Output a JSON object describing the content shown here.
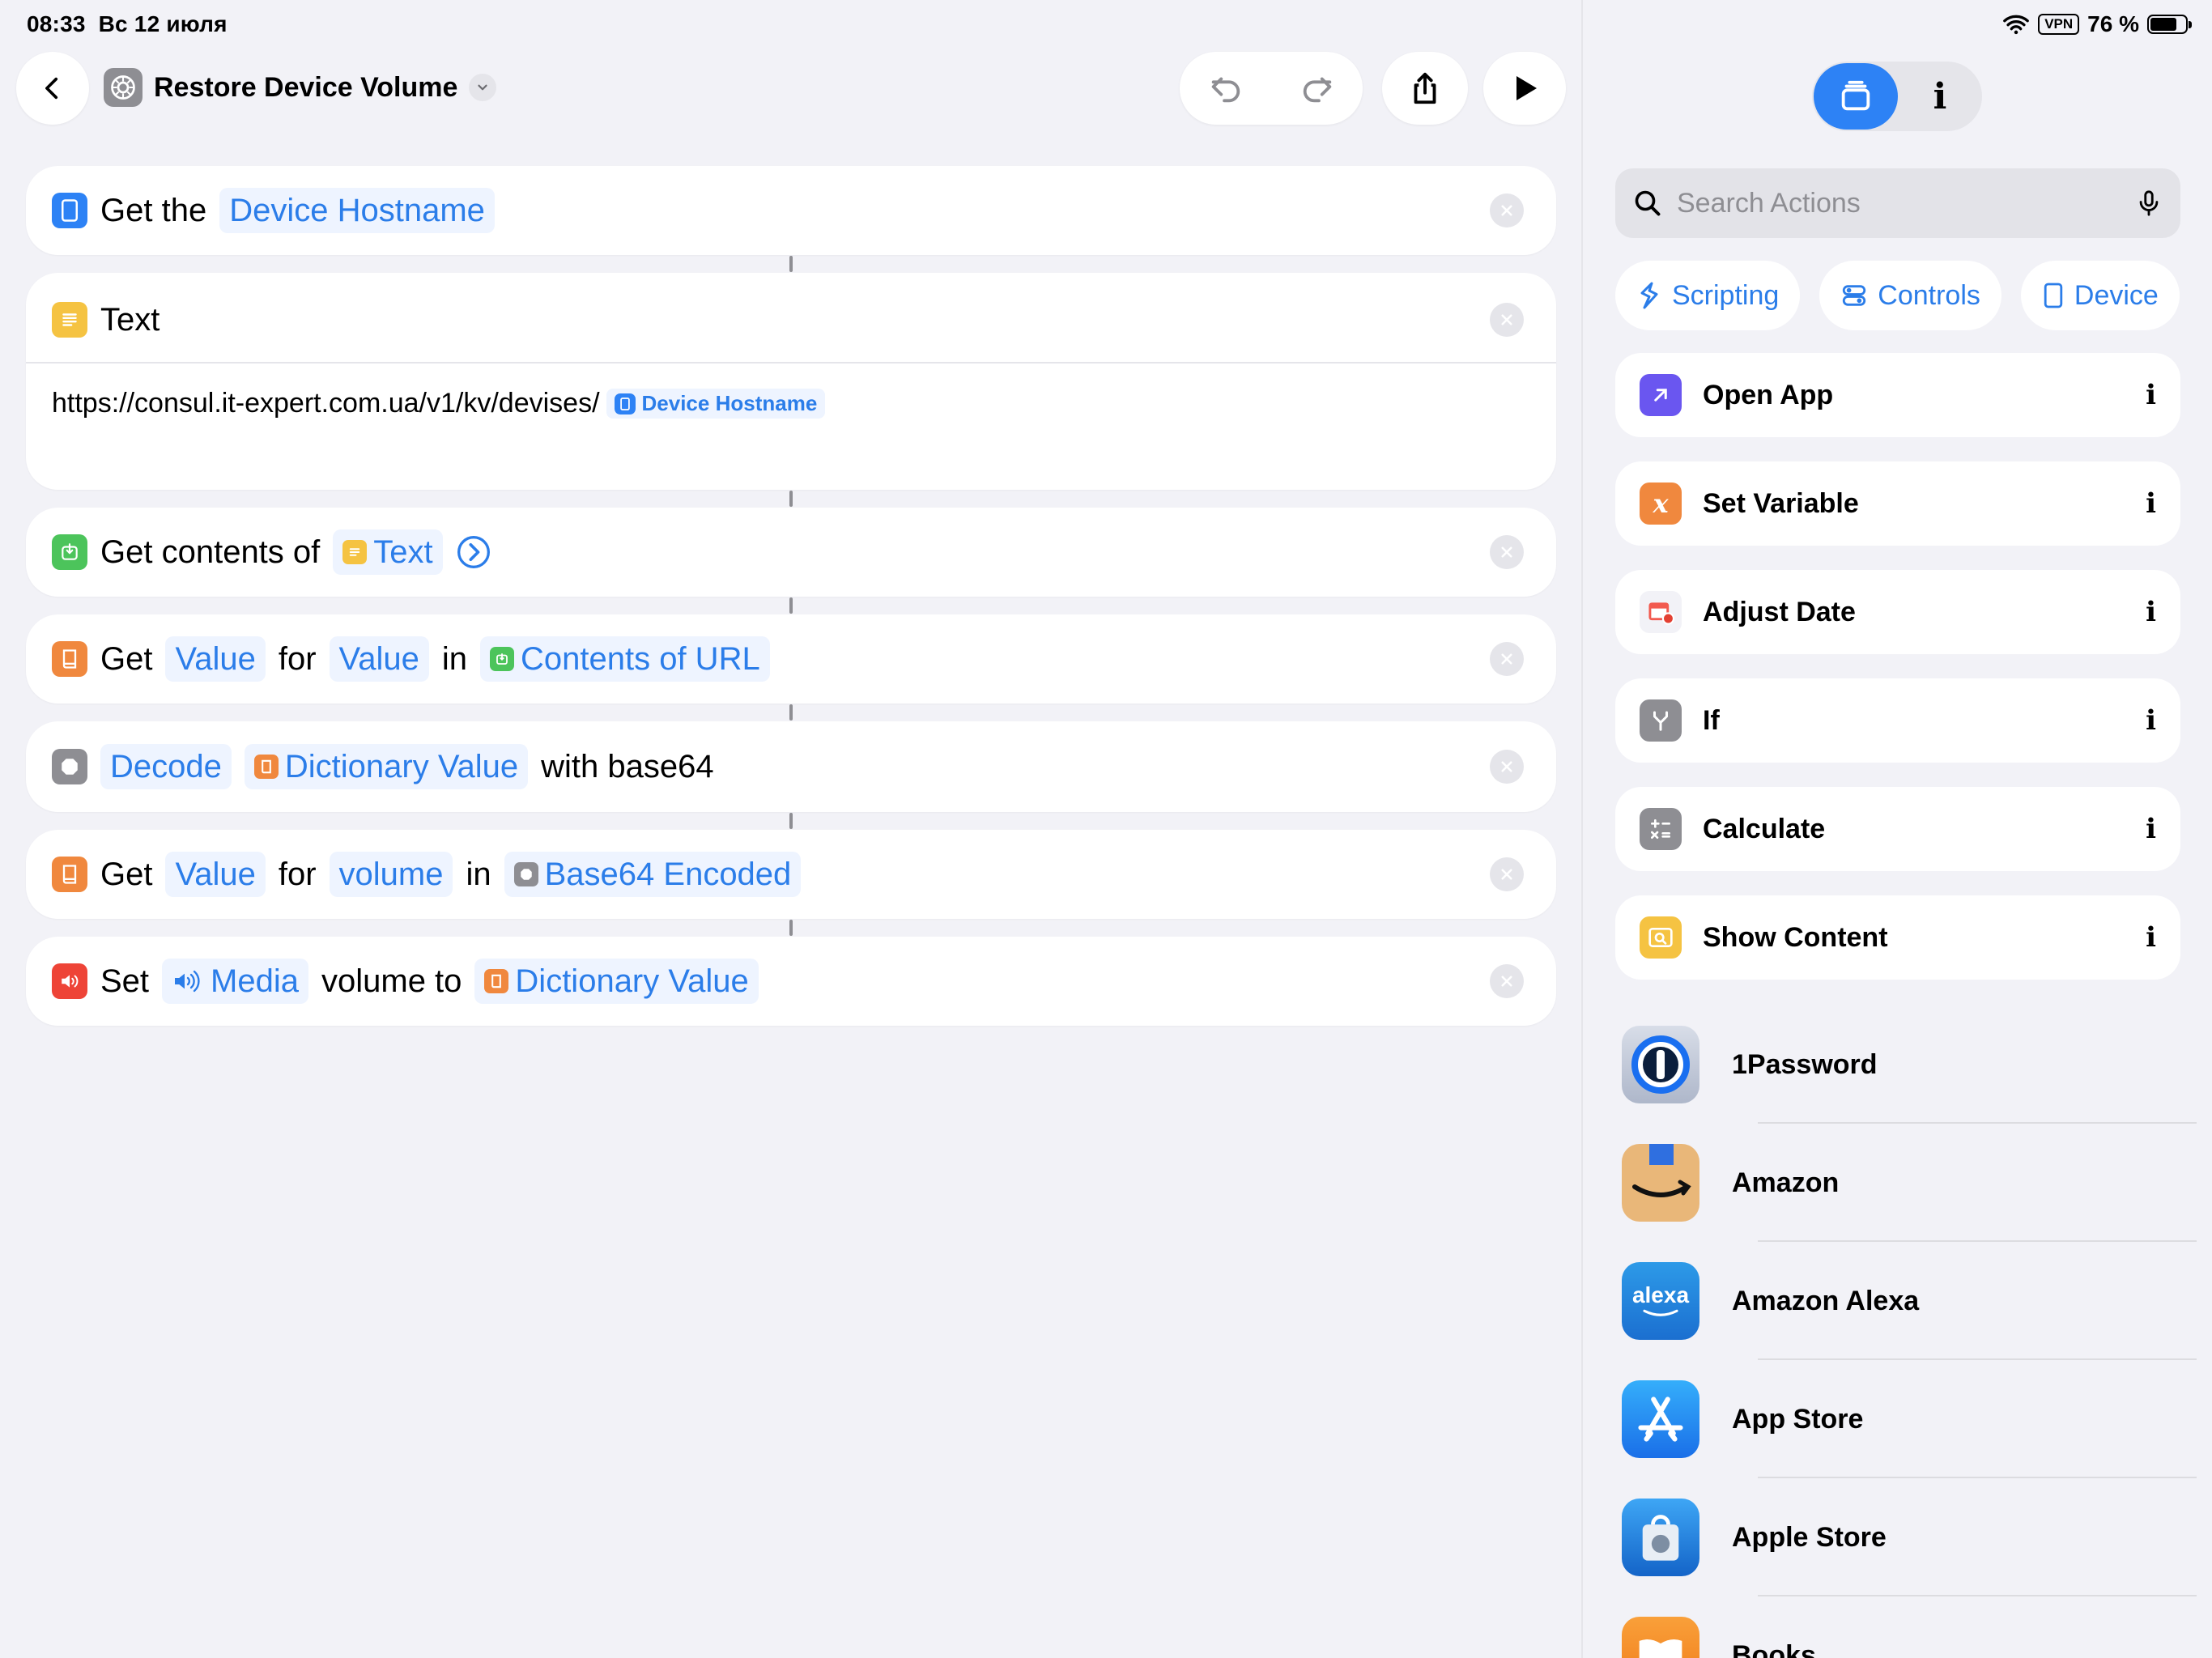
{
  "status": {
    "time": "08:33",
    "date": "Вс 12 июля",
    "vpn": "VPN",
    "battery": "76 %",
    "battery_level": 0.76
  },
  "nav": {
    "title": "Restore Device Volume"
  },
  "actions": {
    "a1": {
      "label": "Get the",
      "token": "Device Hostname"
    },
    "a2": {
      "label": "Text",
      "url": "https://consul.it-expert.com.ua/v1/kv/devises/",
      "token": "Device Hostname"
    },
    "a3": {
      "label": "Get contents of",
      "token": "Text"
    },
    "a4": {
      "w1": "Get",
      "t1": "Value",
      "w2": "for",
      "t2": "Value",
      "w3": "in",
      "t3": "Contents of URL"
    },
    "a5": {
      "t1": "Decode",
      "t2": "Dictionary Value",
      "w1": "with base64"
    },
    "a6": {
      "w1": "Get",
      "t1": "Value",
      "w2": "for",
      "t2": "volume",
      "w3": "in",
      "t3": "Base64 Encoded"
    },
    "a7": {
      "w1": "Set",
      "t1": "Media",
      "w2": "volume to",
      "t2": "Dictionary Value"
    }
  },
  "panel": {
    "search_placeholder": "Search Actions",
    "chips": [
      "Scripting",
      "Controls",
      "Device"
    ],
    "actions": [
      "Open App",
      "Set Variable",
      "Adjust Date",
      "If",
      "Calculate",
      "Show Content"
    ],
    "apps": [
      "1Password",
      "Amazon",
      "Amazon Alexa",
      "App Store",
      "Apple Store",
      "Books"
    ],
    "alexa_logo": "alexa"
  },
  "colors": {
    "accent": "#2b7de9",
    "blue_icon": "#2d82f5",
    "orange": "#f0883e",
    "green": "#4cc45b",
    "yellow": "#f5c342",
    "red": "#ee4437",
    "gray": "#8e8e93",
    "purple": "#6a56f0"
  }
}
